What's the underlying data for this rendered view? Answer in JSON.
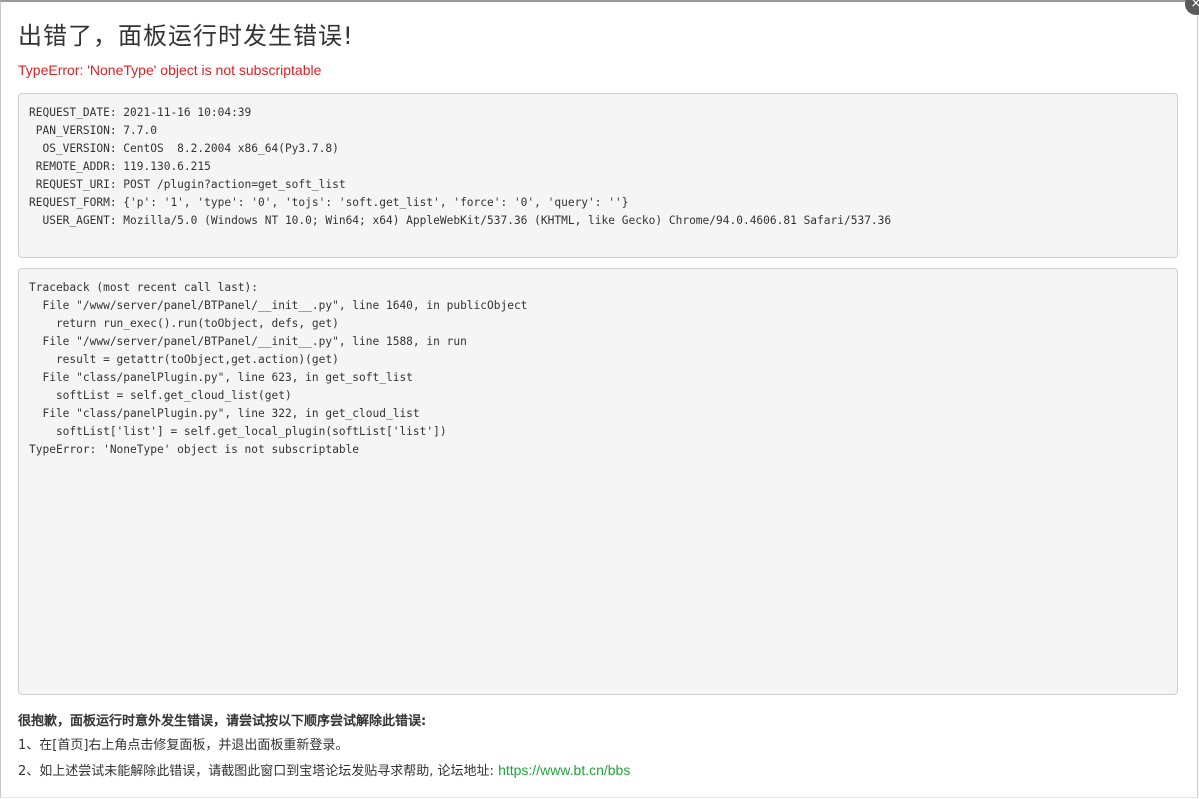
{
  "header": {
    "title": "出错了，面板运行时发生错误!",
    "error_message": "TypeError: 'NoneType' object is not subscriptable",
    "close_icon": "×"
  },
  "request_info": [
    "REQUEST_DATE: 2021-11-16 10:04:39",
    " PAN_VERSION: 7.7.0",
    "  OS_VERSION: CentOS  8.2.2004 x86_64(Py3.7.8)",
    " REMOTE_ADDR: 119.130.6.215",
    " REQUEST_URI: POST /plugin?action=get_soft_list",
    "REQUEST_FORM: {'p': '1', 'type': '0', 'tojs': 'soft.get_list', 'force': '0', 'query': ''}",
    "  USER_AGENT: Mozilla/5.0 (Windows NT 10.0; Win64; x64) AppleWebKit/537.36 (KHTML, like Gecko) Chrome/94.0.4606.81 Safari/537.36"
  ],
  "traceback": [
    "Traceback (most recent call last):",
    "  File \"/www/server/panel/BTPanel/__init__.py\", line 1640, in publicObject",
    "    return run_exec().run(toObject, defs, get)",
    "  File \"/www/server/panel/BTPanel/__init__.py\", line 1588, in run",
    "    result = getattr(toObject,get.action)(get)",
    "  File \"class/panelPlugin.py\", line 623, in get_soft_list",
    "    softList = self.get_cloud_list(get)",
    "  File \"class/panelPlugin.py\", line 322, in get_cloud_list",
    "    softList['list'] = self.get_local_plugin(softList['list'])",
    "TypeError: 'NoneType' object is not subscriptable"
  ],
  "help": {
    "title": "很抱歉，面板运行时意外发生错误，请尝试按以下顺序尝试解除此错误:",
    "step1": "1、在[首页]右上角点击修复面板，并退出面板重新登录。",
    "step2_text": "2、如上述尝试未能解除此错误，请截图此窗口到宝塔论坛发贴寻求帮助, 论坛地址: ",
    "forum_url": "https://www.bt.cn/bbs"
  },
  "colors": {
    "error": "#e02020",
    "link": "#20a53a"
  }
}
